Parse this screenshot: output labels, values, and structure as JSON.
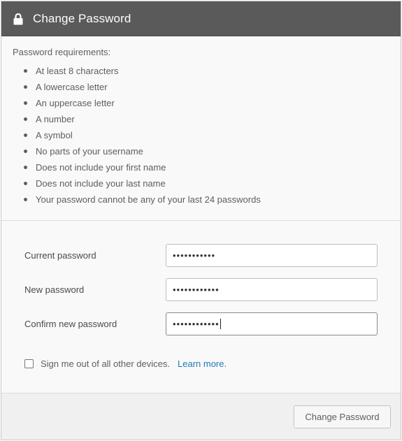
{
  "header": {
    "title": "Change Password",
    "icon": "lock-icon"
  },
  "requirements": {
    "title": "Password requirements:",
    "items": [
      "At least 8 characters",
      "A lowercase letter",
      "An uppercase letter",
      "A number",
      "A symbol",
      "No parts of your username",
      "Does not include your first name",
      "Does not include your last name",
      "Your password cannot be any of your last 24 passwords"
    ]
  },
  "form": {
    "current": {
      "label": "Current password",
      "value": "•••••••••••"
    },
    "new": {
      "label": "New password",
      "value": "••••••••••••"
    },
    "confirm": {
      "label": "Confirm new password",
      "value": "••••••••••••"
    },
    "signout": {
      "label": "Sign me out of all other devices.",
      "link": "Learn more.",
      "checked": false
    }
  },
  "footer": {
    "submit_label": "Change Password"
  },
  "colors": {
    "header_bg": "#5a5a5a",
    "link": "#1f79b6"
  }
}
